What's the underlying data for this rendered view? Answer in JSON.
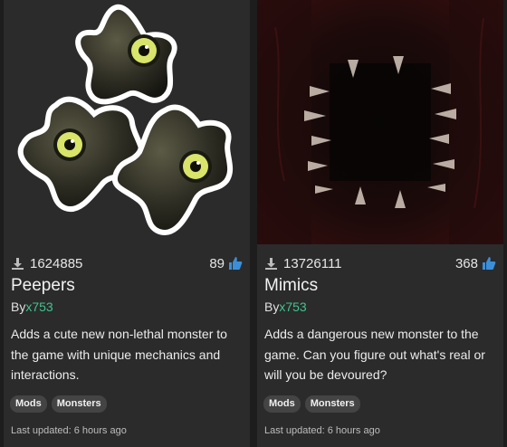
{
  "cards": [
    {
      "downloads": "1624885",
      "likes": "89",
      "title": "Peepers",
      "by": "By",
      "author": "x753",
      "description": "Adds a cute new non-lethal monster to the game with unique mechanics and interactions.",
      "tags": [
        "Mods",
        "Monsters"
      ],
      "updated": "Last updated: 6 hours ago"
    },
    {
      "downloads": "13726111",
      "likes": "368",
      "title": "Mimics",
      "by": "By",
      "author": "x753",
      "description": "Adds a dangerous new monster to the game. Can you figure out what's real or will you be devoured?",
      "tags": [
        "Mods",
        "Monsters"
      ],
      "updated": "Last updated: 6 hours ago"
    }
  ],
  "icons": {
    "download": "download-icon",
    "like": "thumbs-up-icon"
  },
  "colors": {
    "author": "#3fc48d",
    "like": "#3b8fd9",
    "card_bg": "#2b2b2b"
  }
}
